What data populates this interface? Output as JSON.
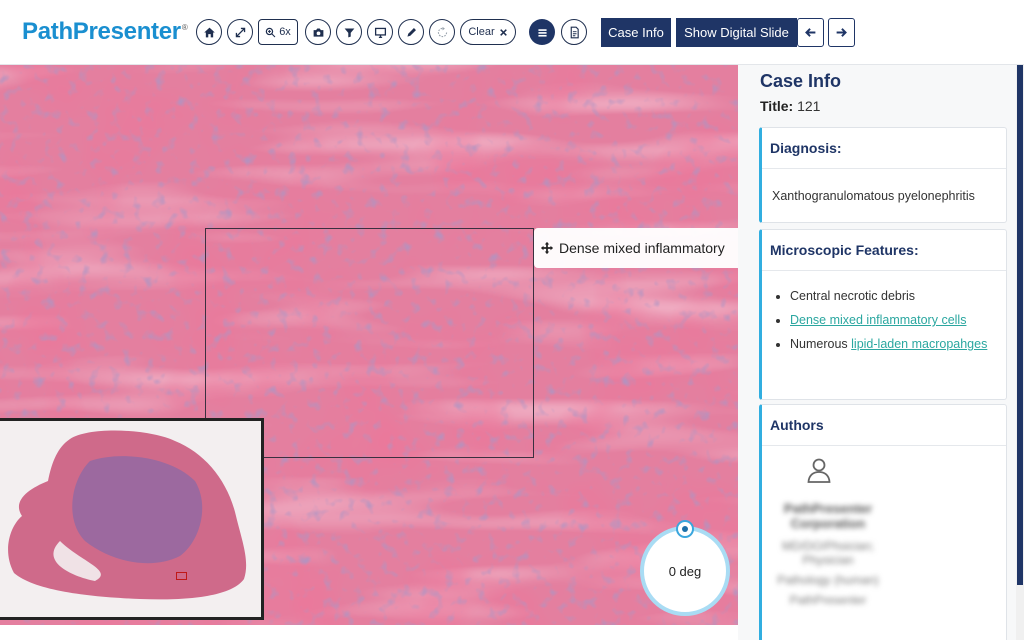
{
  "app": {
    "name": "PathPresenter",
    "trademark": "®"
  },
  "toolbar": {
    "buttons": [
      {
        "name": "home-button",
        "icon": "home-icon"
      },
      {
        "name": "fullscreen-button",
        "icon": "expand-arrows-icon"
      },
      {
        "name": "zoom-level-button",
        "icon": "zoom-in-icon",
        "label": "6x"
      },
      {
        "name": "snapshot-button",
        "icon": "camera-icon"
      },
      {
        "name": "filter-button",
        "icon": "funnel-icon"
      },
      {
        "name": "present-button",
        "icon": "monitor-icon"
      },
      {
        "name": "annotate-button",
        "icon": "pencil-icon"
      },
      {
        "name": "rotate-button",
        "icon": "rotate-icon"
      },
      {
        "name": "clear-button",
        "icon": "close-icon",
        "label": "Clear"
      }
    ],
    "list_icon": "list-icon",
    "notes_icon": "document-icon",
    "case_info_label": "Case Info",
    "show_digital_slide_label": "Show Digital Slide",
    "prev_icon": "arrow-left-icon",
    "next_icon": "arrow-right-icon"
  },
  "viewer": {
    "annotation_label": "Dense mixed inflammatory",
    "rotation": "0 deg"
  },
  "panel": {
    "title": "Case Info",
    "case_title_label": "Title:",
    "case_title_value": "121",
    "diagnosis": {
      "heading": "Diagnosis:",
      "text": "Xanthogranulomatous pyelonephritis"
    },
    "microscopic": {
      "heading": "Microscopic Features:",
      "item1": "Central necrotic debris",
      "item2_link": "Dense mixed inflammatory cells",
      "item3_text": "Numerous ",
      "item3_link": "lipid-laden macropahges"
    },
    "authors": {
      "heading": "Authors",
      "author_name": "PathPresenter Corporation",
      "author_line1": "MD/DO/Phsician; Physician",
      "author_line2": "Pathology (human)",
      "author_line3": "PathPresenter"
    }
  },
  "colors": {
    "brand": "#1a8fd0",
    "navy": "#1f3566",
    "accent": "#31aee0",
    "link": "#2ba7a0"
  }
}
